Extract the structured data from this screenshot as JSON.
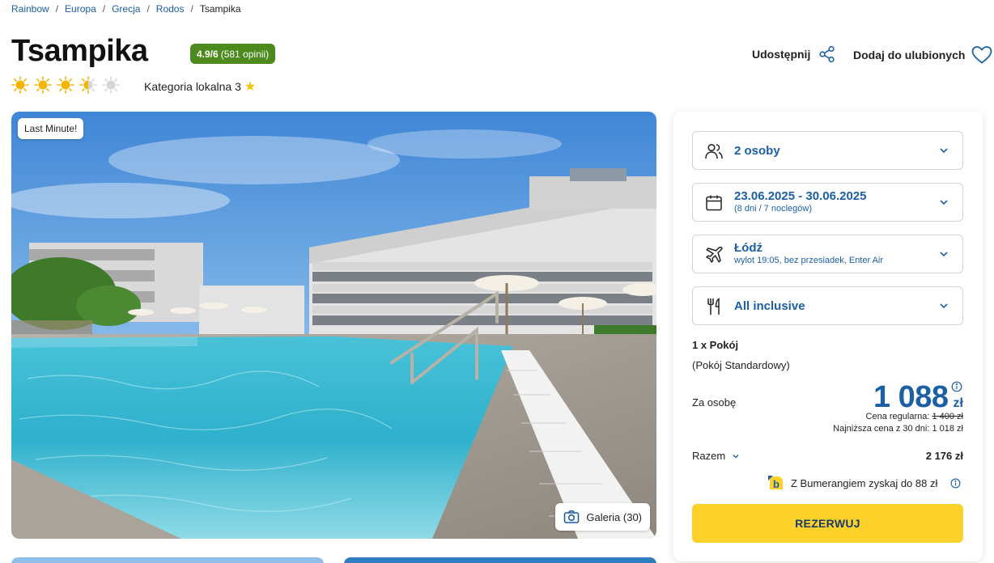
{
  "breadcrumb": [
    {
      "label": "Rainbow"
    },
    {
      "label": "Europa"
    },
    {
      "label": "Grecja"
    },
    {
      "label": "Rodos"
    },
    {
      "label": "Tsampika",
      "current": true
    }
  ],
  "hotel": {
    "name": "Tsampika",
    "rating_score": "4.9/6",
    "rating_count": "(581 opinii)",
    "suns_full": 3,
    "suns_half": 1,
    "suns_max": 5,
    "local_category": "Kategoria lokalna 3"
  },
  "actions": {
    "share_label": "Udostępnij",
    "favorite_label": "Dodaj do ulubionych"
  },
  "hero": {
    "badge": "Last Minute!",
    "gallery_label": "Galeria (30)"
  },
  "booking": {
    "persons": "2 osoby",
    "dates": "23.06.2025 - 30.06.2025",
    "dates_sub": "(8 dni / 7 noclegów)",
    "departure": "Łódź",
    "departure_sub": "wylot 19:05, bez przesiadek, Enter Air",
    "board": "All inclusive",
    "room": "1 x Pokój",
    "room_type": "(Pokój Standardowy)",
    "per_person_label": "Za osobę",
    "price": "1 088",
    "currency": "zł",
    "regular_label": "Cena regularna:",
    "regular_price": "1 400 zł",
    "lowest_price_text": "Najniższa cena z 30 dni: 1 018 zł",
    "total_label": "Razem",
    "total_value": "2 176 zł",
    "bumerang_text": "Z Bumerangiem zyskaj do 88 zł",
    "reserve_label": "REZERWUJ"
  },
  "colors": {
    "link_blue": "#1b5fa6",
    "rating_green": "#4c8a1d",
    "reserve_yellow": "#fcd12a",
    "sun_yellow": "#f5b400"
  }
}
